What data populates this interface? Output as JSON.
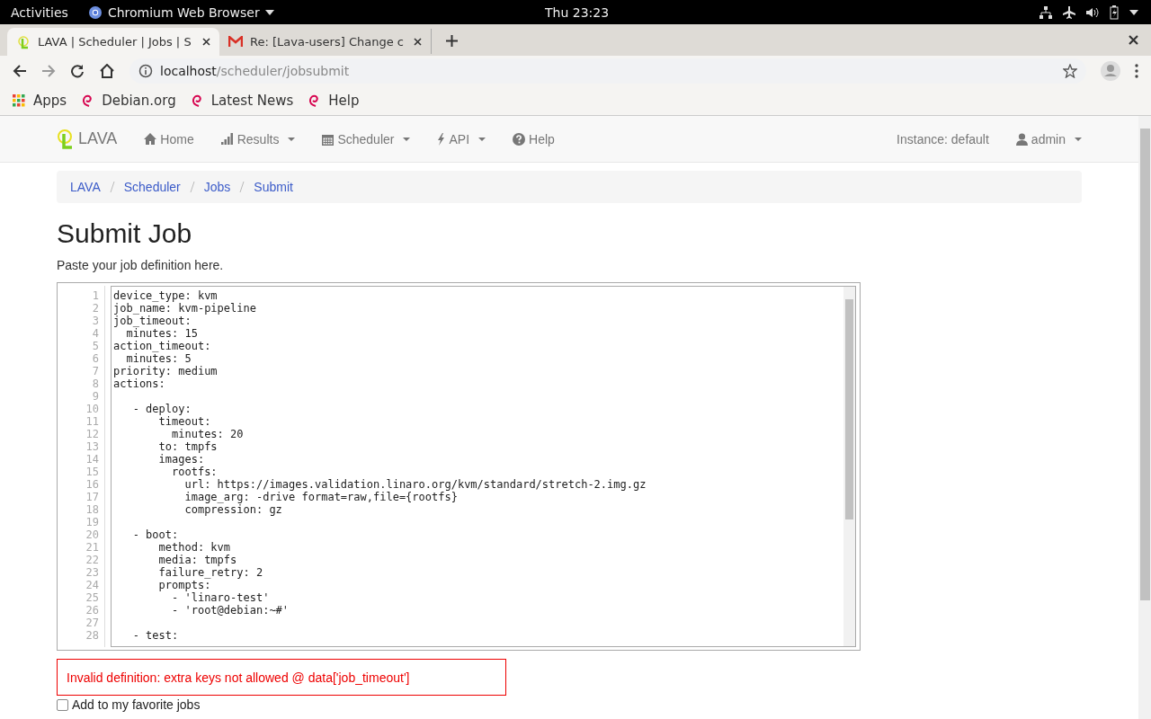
{
  "system_bar": {
    "activities": "Activities",
    "app_name": "Chromium Web Browser",
    "clock": "Thu 23:23"
  },
  "browser": {
    "tabs": [
      {
        "title": "LAVA | Scheduler | Jobs | S",
        "selected": true
      },
      {
        "title": "Re: [Lava-users] Change c",
        "selected": false
      }
    ],
    "url": {
      "host": "localhost",
      "path": "/scheduler/jobsubmit"
    },
    "bookmarks": [
      "Apps",
      "Debian.org",
      "Latest News",
      "Help"
    ]
  },
  "navbar": {
    "brand": "LAVA",
    "items": [
      {
        "label": "Home",
        "dropdown": false
      },
      {
        "label": "Results",
        "dropdown": true
      },
      {
        "label": "Scheduler",
        "dropdown": true
      },
      {
        "label": "API",
        "dropdown": true
      },
      {
        "label": "Help",
        "dropdown": false
      }
    ],
    "instance": "Instance: default",
    "user": {
      "label": "admin",
      "dropdown": true
    }
  },
  "breadcrumb": [
    "LAVA",
    "Scheduler",
    "Jobs",
    "Submit"
  ],
  "heading": "Submit Job",
  "intro": "Paste your job definition here.",
  "editor": {
    "lines": [
      {
        "number": "1",
        "text": "device_type: kvm"
      },
      {
        "number": "2",
        "text": "job_name: kvm-pipeline"
      },
      {
        "number": "3",
        "text": "job_timeout:"
      },
      {
        "number": "4",
        "text": "  minutes: 15"
      },
      {
        "number": "5",
        "text": "action_timeout:"
      },
      {
        "number": "6",
        "text": "  minutes: 5"
      },
      {
        "number": "7",
        "text": "priority: medium"
      },
      {
        "number": "8",
        "text": "actions:"
      },
      {
        "number": "9"
      },
      {
        "number": "10",
        "text": "   - deploy:"
      },
      {
        "number": "11",
        "text": "       timeout:"
      },
      {
        "number": "12",
        "text": "         minutes: 20"
      },
      {
        "number": "13",
        "text": "       to: tmpfs"
      },
      {
        "number": "14",
        "text": "       images:"
      },
      {
        "number": "15",
        "text": "         rootfs:"
      },
      {
        "number": "16",
        "text": "           url: https://images.validation.linaro.org/kvm/standard/stretch-2.img.gz"
      },
      {
        "number": "17",
        "text": "           image_arg: -drive format=raw,file={rootfs}"
      },
      {
        "number": "18",
        "text": "           compression: gz"
      },
      {
        "number": "19"
      },
      {
        "number": "20",
        "text": "   - boot:"
      },
      {
        "number": "21",
        "text": "       method: kvm"
      },
      {
        "number": "22",
        "text": "       media: tmpfs"
      },
      {
        "number": "23",
        "text": "       failure_retry: 2"
      },
      {
        "number": "24",
        "text": "       prompts:"
      },
      {
        "number": "25",
        "text": "         - 'linaro-test'"
      },
      {
        "number": "26",
        "text": "         - 'root@debian:~#'"
      },
      {
        "number": "27"
      },
      {
        "number": "28",
        "text": "   - test:"
      }
    ]
  },
  "error": "Invalid definition: extra keys not allowed @ data['job_timeout']",
  "favorite": {
    "label": "Add to my favorite jobs",
    "checked": false
  }
}
